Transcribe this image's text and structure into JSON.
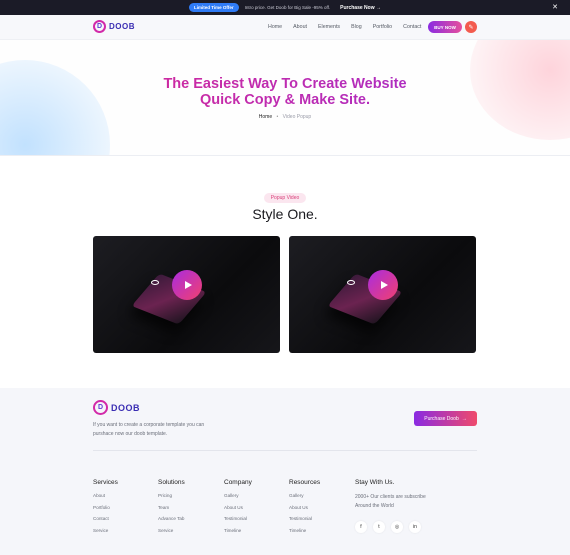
{
  "promo": {
    "badge": "Limited Time Offer",
    "text": "Intro price. Get Doob for Big Sale -95% off.",
    "link": "Purchase Now",
    "close_glyph": "✕"
  },
  "header": {
    "logo_letter": "D",
    "logo_text": "DOOB",
    "nav": [
      "Home",
      "About",
      "Elements",
      "Blog",
      "Portfolio",
      "Contact"
    ],
    "buy_label": "BUY NOW"
  },
  "hero": {
    "title_line1": "The Easiest Way To Create Website",
    "title_line2": "Quick Copy & Make Site.",
    "breadcrumb": {
      "home": "Home",
      "separator": "•",
      "current": "Video Popup"
    }
  },
  "section": {
    "tag": "Popup Video",
    "title": "Style One."
  },
  "videos": [
    {
      "icon": "play-icon"
    },
    {
      "icon": "play-icon"
    }
  ],
  "footer": {
    "logo_letter": "D",
    "logo_text": "DOOB",
    "description": "If you want to create a corporate template you can purshace now our doob template.",
    "cta_label": "Purchase Doob",
    "cta_arrow": "→",
    "columns": [
      {
        "title": "Services",
        "links": [
          "About",
          "Portfolio",
          "Contact",
          "Service"
        ]
      },
      {
        "title": "Solutions",
        "links": [
          "Pricing",
          "Team",
          "Advance Tab",
          "Service"
        ]
      },
      {
        "title": "Company",
        "links": [
          "Gallery",
          "About Us",
          "Testimonial",
          "Timeline"
        ]
      },
      {
        "title": "Resources",
        "links": [
          "Gallery",
          "About Us",
          "Testimonial",
          "Timeline"
        ]
      }
    ],
    "stay": {
      "title": "Stay With Us.",
      "text": "2000+ Our clients are subscribe Around the World",
      "socials": [
        {
          "icon": "facebook-icon",
          "glyph": "f"
        },
        {
          "icon": "twitter-icon",
          "glyph": "t"
        },
        {
          "icon": "instagram-icon",
          "glyph": "◎"
        },
        {
          "icon": "linkedin-icon",
          "glyph": "in"
        }
      ]
    }
  },
  "colors": {
    "accent_start": "#8a2be2",
    "accent_end": "#e64f9c",
    "promo_bg": "#1b1b27"
  }
}
